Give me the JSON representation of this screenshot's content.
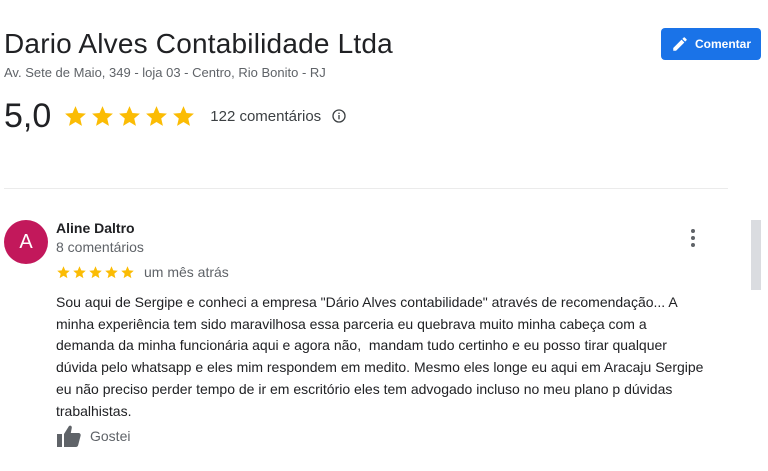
{
  "business": {
    "name": "Dario Alves Contabilidade Ltda",
    "address": "Av. Sete de Maio, 349 - loja 03 - Centro, Rio Bonito - RJ"
  },
  "comment_button": {
    "label": "Comentar",
    "icon": "pencil-icon"
  },
  "rating": {
    "value": "5,0",
    "stars": 5,
    "count_label": "122 comentários",
    "info_icon": "info-icon"
  },
  "colors": {
    "star": "#fbbc04",
    "primary": "#1a73e8",
    "avatar_bg": "#c2185b"
  },
  "review": {
    "avatar_letter": "A",
    "author": "Aline Daltro",
    "author_meta": "8 comentários",
    "stars": 5,
    "date": "um mês atrás",
    "text": "Sou aqui de Sergipe e conheci a empresa \"Dário Alves contabilidade\" através de recomendação... A\nminha experiência tem sido maravilhosa essa parceria eu quebrava muito minha cabeça com a\ndemanda da minha funcionária aqui e agora não,  mandam tudo certinho e eu posso tirar qualquer\ndúvida pelo whatsapp e eles mim respondem em medito. Mesmo eles longe eu aqui em Aracaju Sergipe\neu não preciso perder tempo de ir em escritório eles tem advogado incluso no meu plano p dúvidas\ntrabalhistas.",
    "like_label": "Gostei",
    "like_icon": "thumbs-up-icon",
    "more_icon": "more-vert-icon"
  }
}
